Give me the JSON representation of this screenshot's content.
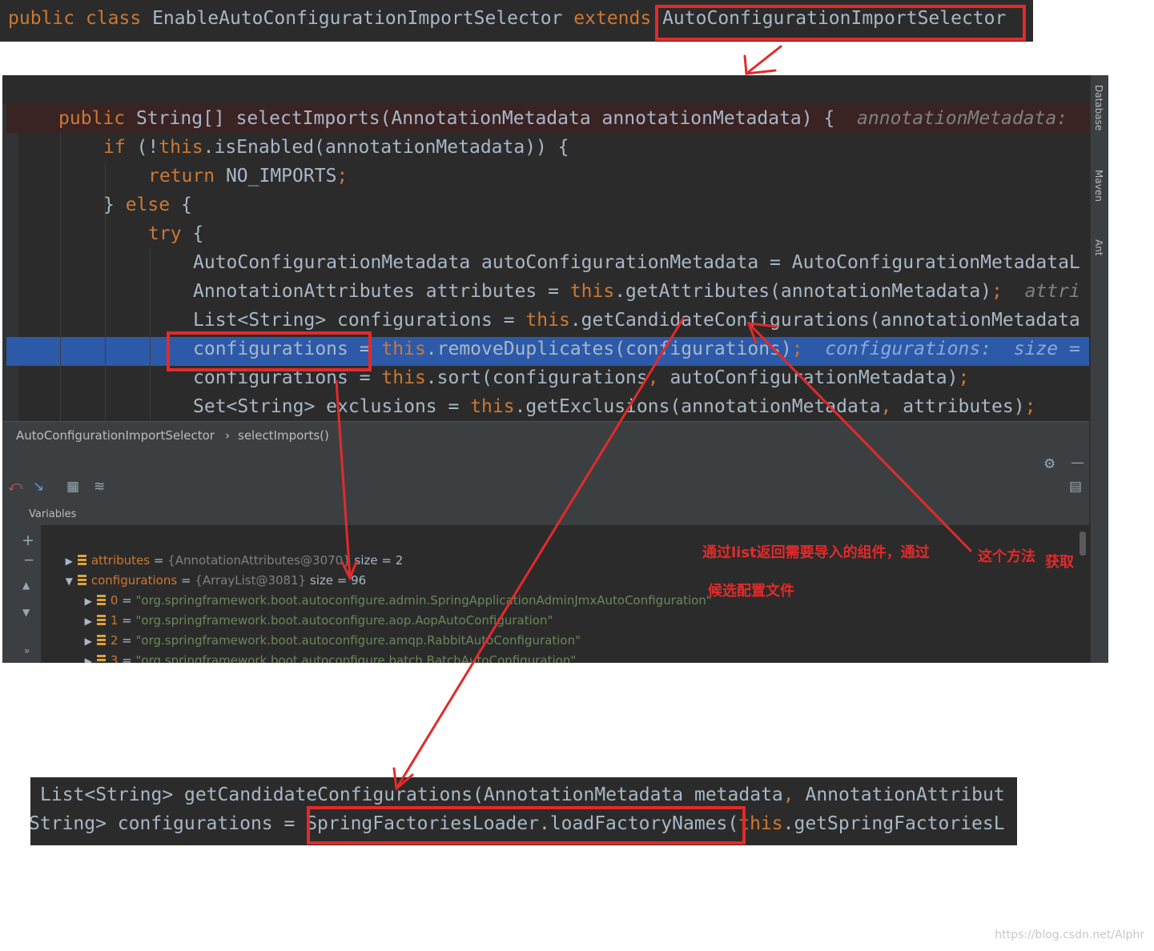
{
  "top": {
    "kw_public": "public",
    "kw_class": "class",
    "class_name": "EnableAutoConfigurationImportSelector",
    "kw_extends": "extends",
    "parent": "AutoConfigurationImportSelector"
  },
  "ide": {
    "side_tabs": [
      "Database",
      "Maven",
      "Ant"
    ],
    "code": {
      "l1_kw": "public",
      "l1_text": "String[] selectImports(AnnotationMetadata annotationMetadata) {",
      "l1_hint": "annotationMetadata:",
      "l2_kw": "if",
      "l2_a": " (!",
      "l2_this": "this",
      "l2_b": ".isEnabled(annotationMetadata)) {",
      "l3_kw": "return",
      "l3_text": " NO_IMPORTS",
      "l3_semi": ";",
      "l4_a": "} ",
      "l4_kw": "else",
      "l4_b": " {",
      "l5_kw": "try",
      "l5_b": " {",
      "l6_text": "AutoConfigurationMetadata autoConfigurationMetadata = AutoConfigurationMetadataL",
      "l7_a": "AnnotationAttributes attributes = ",
      "l7_this": "this",
      "l7_b": ".getAttributes(annotationMetadata)",
      "l7_semi": ";",
      "l7_hint": "attri",
      "l8_a": "List<String> configurations = ",
      "l8_this": "this",
      "l8_b": ".getCandidateConfigurations(annotationMetadata",
      "l9_a": "configurations = ",
      "l9_this": "this",
      "l9_b": ".removeDuplicates(configurations)",
      "l9_semi": ";",
      "l9_hint": "configurations:  size =",
      "l10_a": "configurations = ",
      "l10_this": "this",
      "l10_b": ".sort(configurations",
      "l10_comma": ",",
      "l10_c": " autoConfigurationMetadata)",
      "l10_semi": ";",
      "l11_a": "Set<String> exclusions = ",
      "l11_this": "this",
      "l11_b": ".getExclusions(annotationMetadata",
      "l11_comma": ",",
      "l11_c": " attributes)",
      "l11_semi": ";"
    },
    "breadcrumb": {
      "class": "AutoConfigurationImportSelector",
      "sep": "›",
      "method": "selectImports()"
    },
    "variables_title": "Variables",
    "variables": [
      {
        "name": "attributes",
        "ref": "{AnnotationAttributes@3070}",
        "extra": " size = 2"
      },
      {
        "name": "configurations",
        "ref": "{ArrayList@3081}",
        "extra": " size = 96"
      }
    ],
    "items": [
      {
        "idx": "0",
        "val": "\"org.springframework.boot.autoconfigure.admin.SpringApplicationAdminJmxAutoConfiguration\""
      },
      {
        "idx": "1",
        "val": "\"org.springframework.boot.autoconfigure.aop.AopAutoConfiguration\""
      },
      {
        "idx": "2",
        "val": "\"org.springframework.boot.autoconfigure.amqp.RabbitAutoConfiguration\""
      },
      {
        "idx": "3",
        "val": "\"org.springframework.boot.autoconfigure.batch.BatchAutoConfiguration\""
      }
    ]
  },
  "annotations": {
    "text1": "通过list返回需要导入的组件，通过",
    "text2": "这个方法",
    "text3": "获取",
    "text4": "候选配置文件",
    "color": "#e32a2a"
  },
  "bottom": {
    "l1_a": "List<String> getCandidateConfigurations(AnnotationMetadata metadata",
    "l1_comma": ",",
    "l1_b": " AnnotationAttribut",
    "l2_a": "String> configurations = ",
    "l2_call": "SpringFactoriesLoader.loadFactoryNames(",
    "l2_this": "this",
    "l2_b": ".getSpringFactoriesL"
  },
  "watermark": "https://blog.csdn.net/Alphr"
}
